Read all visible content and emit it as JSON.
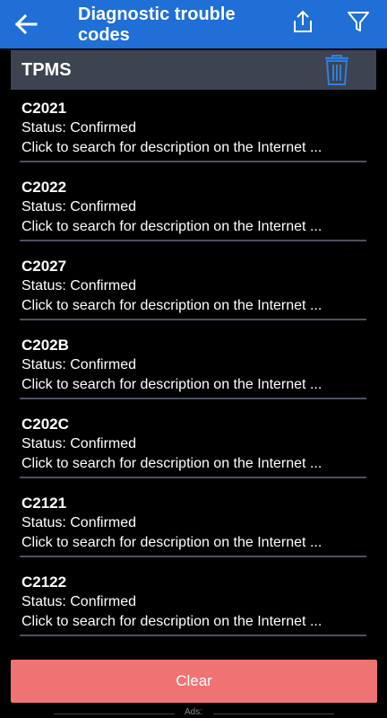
{
  "appbar": {
    "title": "Diagnostic trouble codes"
  },
  "section": {
    "title": "TPMS"
  },
  "items": [
    {
      "code": "C2021",
      "status": "Status: Confirmed",
      "desc": "Click to search for description on the Internet ..."
    },
    {
      "code": "C2022",
      "status": "Status: Confirmed",
      "desc": "Click to search for description on the Internet ..."
    },
    {
      "code": "C2027",
      "status": "Status: Confirmed",
      "desc": "Click to search for description on the Internet ..."
    },
    {
      "code": "C202B",
      "status": "Status: Confirmed",
      "desc": "Click to search for description on the Internet ..."
    },
    {
      "code": "C202C",
      "status": "Status: Confirmed",
      "desc": "Click to search for description on the Internet ..."
    },
    {
      "code": "C2121",
      "status": "Status: Confirmed",
      "desc": "Click to search for description on the Internet ..."
    },
    {
      "code": "C2122",
      "status": "Status: Confirmed",
      "desc": "Click to search for description on the Internet ..."
    }
  ],
  "clear_label": "Clear",
  "ads_label": "Ads:",
  "colors": {
    "appbar": "#1f6fd6",
    "section_header": "#3d4350",
    "clear_button": "#f07373",
    "trash_icon": "#2f7fe0"
  },
  "icons": {
    "back": "arrow-left-icon",
    "share": "share-upload-icon",
    "filter": "filter-funnel-icon",
    "trash": "trash-icon"
  }
}
